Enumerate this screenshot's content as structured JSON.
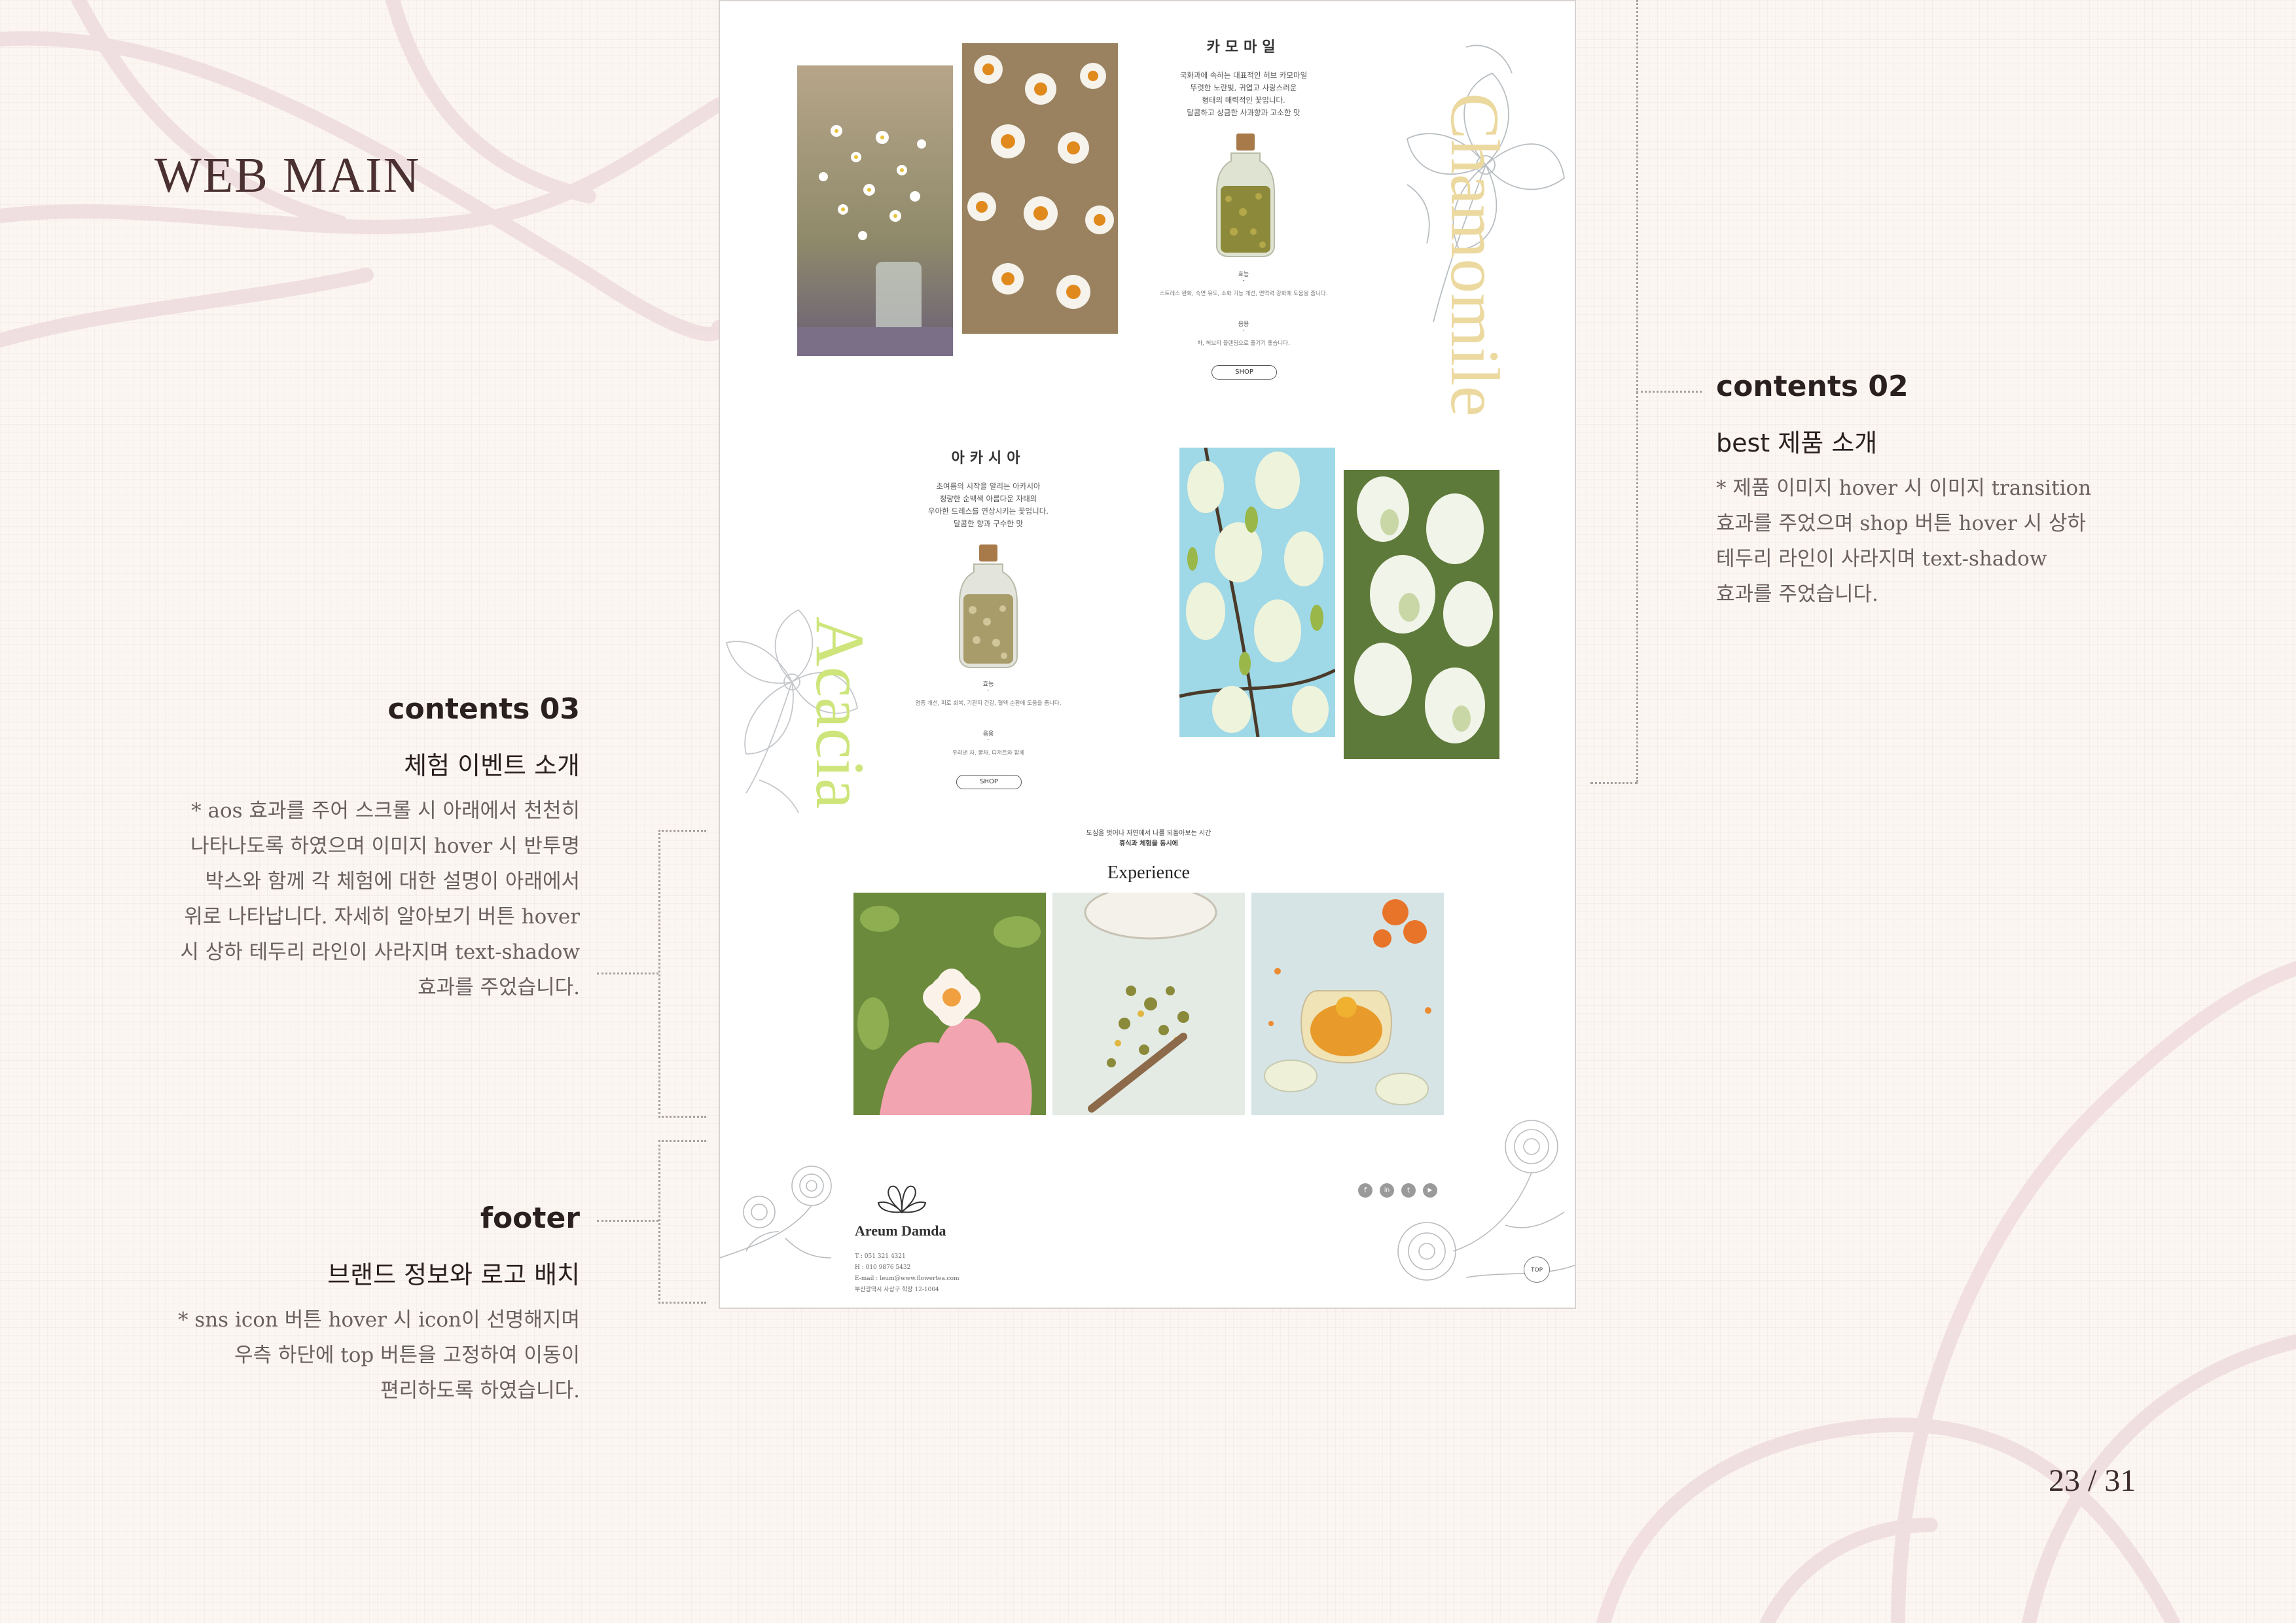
{
  "page": {
    "heading": "WEB MAIN",
    "number": "23 / 31"
  },
  "annotations": {
    "contents02": {
      "title": "contents 02",
      "subtitle": "best 제품 소개",
      "lines": [
        "* 제품 이미지 hover 시 이미지 transition",
        "효과를 주었으며 shop 버튼 hover 시 상하",
        "테두리 라인이 사라지며 text-shadow",
        "효과를 주었습니다."
      ]
    },
    "contents03": {
      "title": "contents 03",
      "subtitle": "체험 이벤트 소개",
      "lines": [
        "* aos 효과를 주어 스크롤 시 아래에서 천천히",
        "나타나도록 하였으며 이미지 hover 시 반투명",
        "박스와 함께 각 체험에 대한 설명이 아래에서",
        "위로 나타납니다. 자세히 알아보기 버튼 hover",
        "시 상하 테두리 라인이 사라지며 text-shadow",
        "효과를 주었습니다."
      ]
    },
    "footer": {
      "title": "footer",
      "subtitle": "브랜드 정보와 로고 배치",
      "lines": [
        "* sns icon 버튼 hover 시 icon이 선명해지며",
        "우측 하단에 top 버튼을 고정하여 이동이",
        "편리하도록 하였습니다."
      ]
    }
  },
  "mockup": {
    "chamomile": {
      "title": "카모마일",
      "desc": [
        "국화과에 속하는 대표적인 허브 카모마일",
        "뚜렷한 노란빛, 귀엽고 사랑스러운",
        "형태의 매력적인 꽃입니다.",
        "달콤하고 상큼한 사과향과 고소한 맛"
      ],
      "label1": "효능",
      "text1": "스트레스 완화, 숙면 유도, 소화 기능 개선, 면역력 강화에 도움을 줍니다.",
      "label2": "음용",
      "text2": "차, 허브티 블렌딩으로 즐기기 좋습니다.",
      "shop": "SHOP",
      "vertical": "Chamomile",
      "vertical_color": "#ecd9a0"
    },
    "acacia": {
      "title": "아카시아",
      "desc": [
        "초여름의 시작을 알리는 아카시아",
        "청량한 순백색 아름다운 자태의",
        "우아한 드레스를 연상시키는 꽃입니다.",
        "달콤한 향과 구수한 맛"
      ],
      "label1": "효능",
      "text1": "염증 개선, 피로 회복, 기관지 건강, 혈액 순환에 도움을 줍니다.",
      "label2": "음용",
      "text2": "우려낸 차, 꿀차, 디저트와 함께",
      "shop": "SHOP",
      "vertical": "Acacia",
      "vertical_color": "#cde57a"
    },
    "experience": {
      "caption1": "도심을 벗어나 자연에서 나를 되돌아보는 시간",
      "caption2": "휴식과 체험을 동시에",
      "title": "Experience"
    },
    "footer": {
      "brand": "Areum Damda",
      "info": [
        "T : 051 321 4321",
        "H : 010 9876 5432",
        "E-mail : leum@www.flowertea.com",
        "부산광역시 사상구 학장 12-1004"
      ],
      "sns": [
        "f",
        "in",
        "t",
        "▶"
      ],
      "top": "TOP"
    }
  },
  "colors": {
    "heading": "#4a3030",
    "annot_desc": "#6a6060",
    "chamomile_accent": "#ecd9a0",
    "acacia_accent": "#cde57a"
  }
}
